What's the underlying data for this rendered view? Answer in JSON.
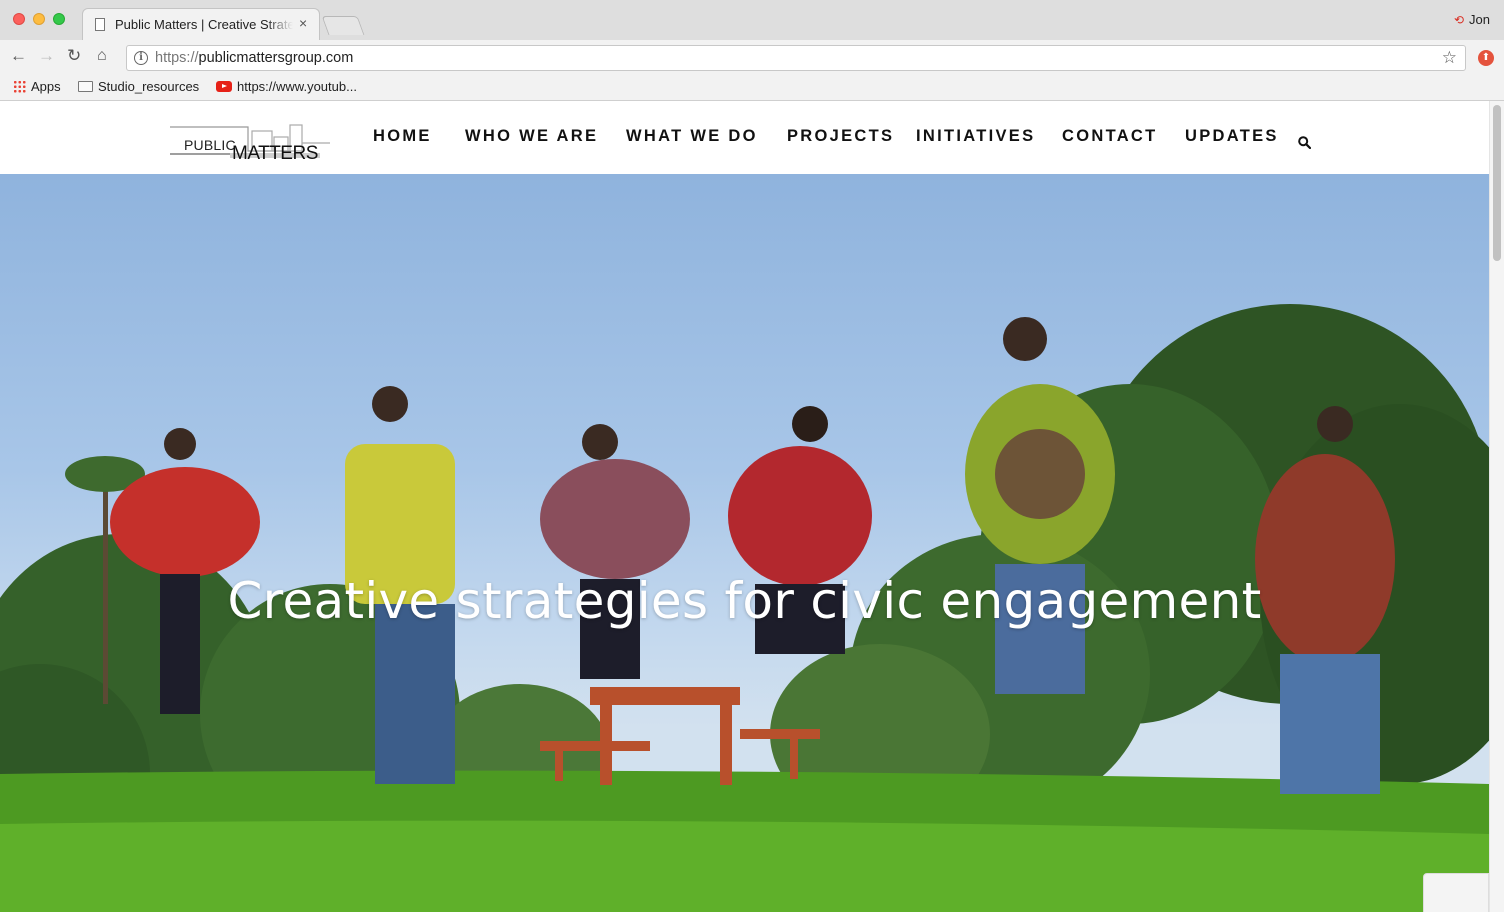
{
  "browser": {
    "tab_title": "Public Matters | Creative Strategies for Civic Engagement",
    "tab_close": "×",
    "profile_name": "Jon",
    "url_scheme": "https://",
    "url_host": "publicmattersgroup.com",
    "bookmarks": [
      {
        "label": "Apps",
        "icon": "apps-grid-icon"
      },
      {
        "label": "Studio_resources",
        "icon": "folder-icon"
      },
      {
        "label": "https://www.youtub...",
        "icon": "youtube-icon"
      }
    ]
  },
  "site": {
    "logo": {
      "line1": "PUBLIC",
      "line2": "MATTERS"
    },
    "nav": [
      "HOME",
      "WHO WE ARE",
      "WHAT WE DO",
      "PROJECTS",
      "INITIATIVES",
      "CONTACT",
      "UPDATES"
    ],
    "hero_title": "Creative strategies for civic engagement"
  }
}
